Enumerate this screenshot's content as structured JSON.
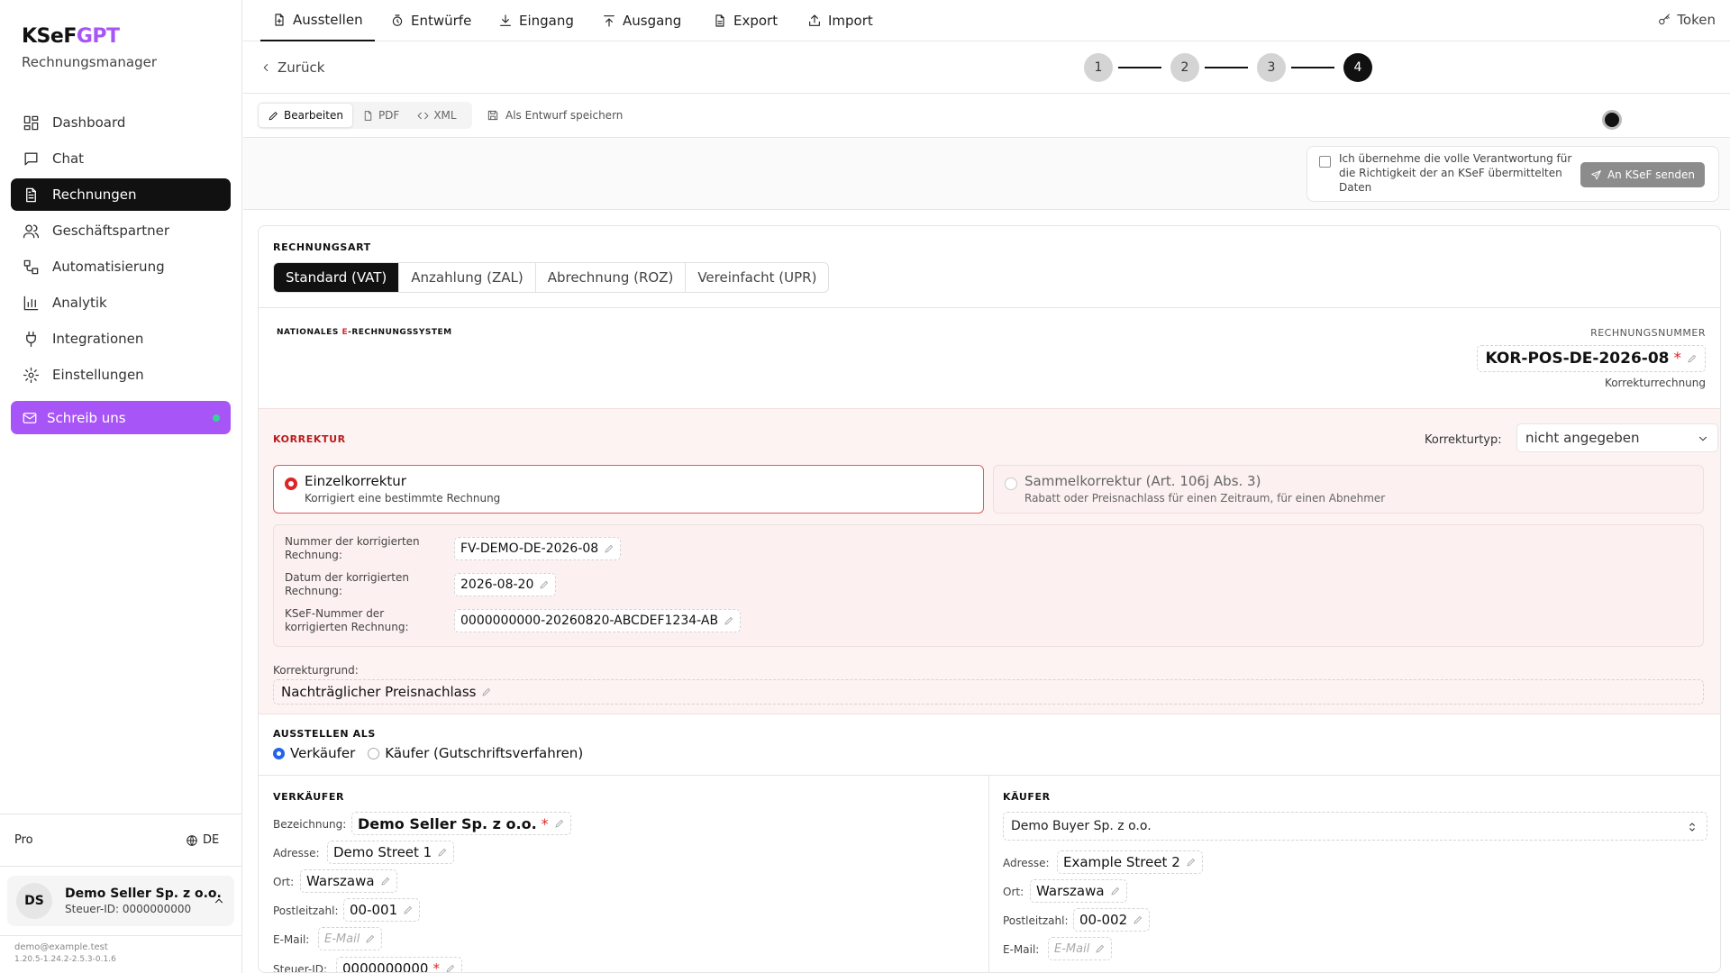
{
  "brand": {
    "name_a": "KSeF",
    "name_b": "GPT",
    "subtitle": "Rechnungsmanager",
    "accent": "#a855f7"
  },
  "sidebar": {
    "items": [
      {
        "label": "Dashboard",
        "icon": "dashboard-icon"
      },
      {
        "label": "Chat",
        "icon": "chat-icon"
      },
      {
        "label": "Rechnungen",
        "icon": "invoice-icon",
        "active": true
      },
      {
        "label": "Geschäftspartner",
        "icon": "users-icon"
      },
      {
        "label": "Automatisierung",
        "icon": "workflow-icon"
      },
      {
        "label": "Analytik",
        "icon": "chart-icon"
      },
      {
        "label": "Integrationen",
        "icon": "plug-icon"
      },
      {
        "label": "Einstellungen",
        "icon": "gear-icon"
      }
    ],
    "cta": "Schreib uns",
    "plan": "Pro",
    "lang": "DE",
    "user": {
      "initials": "DS",
      "name": "Demo Seller Sp. z o.o.",
      "tax_id": "Steuer-ID: 0000000000"
    },
    "email": "demo@example.test",
    "version": "1.20.5-1.24.2-2.5.3-0.1.6"
  },
  "topnav": {
    "tabs": [
      {
        "label": "Ausstellen",
        "icon": "file-plus-icon",
        "active": true
      },
      {
        "label": "Entwürfe",
        "icon": "drafts-icon"
      },
      {
        "label": "Eingang",
        "icon": "download-icon"
      },
      {
        "label": "Ausgang",
        "icon": "upload-icon"
      },
      {
        "label": "Export",
        "icon": "file-export-icon"
      },
      {
        "label": "Import",
        "icon": "import-icon"
      }
    ],
    "token": "Token"
  },
  "back": "Zurück",
  "steps": [
    "1",
    "2",
    "3",
    "4"
  ],
  "current_step": 4,
  "toolbar": {
    "edit": "Bearbeiten",
    "pdf": "PDF",
    "xml": "XML",
    "save_draft": "Als Entwurf speichern"
  },
  "confirm": {
    "text": "Ich übernehme die volle Verantwortung für die Richtigkeit der an KSeF übermittelten Daten",
    "send": "An KSeF senden"
  },
  "invoice_type": {
    "title": "RECHNUNGSART",
    "options": [
      "Standard (VAT)",
      "Anzahlung (ZAL)",
      "Abrechnung (ROZ)",
      "Vereinfacht (UPR)"
    ],
    "selected": "Standard (VAT)"
  },
  "header": {
    "system_a": "NATIONALES ",
    "system_b": "E",
    "system_c": "-RECHNUNGSSYSTEM",
    "number_label": "RECHNUNGSNUMMER",
    "number": "KOR-POS-DE-2026-08",
    "required": "*",
    "number_sub": "Korrekturrechnung"
  },
  "correction": {
    "title": "KORREKTUR",
    "type_label": "Korrekturtyp:",
    "type_value": "nicht angegeben",
    "opt1_title": "Einzelkorrektur",
    "opt1_desc": "Korrigiert eine bestimmte Rechnung",
    "opt2_title": "Sammelkorrektur (Art. 106j Abs. 3)",
    "opt2_desc": "Rabatt oder Preisnachlass für einen Zeitraum, für einen Abnehmer",
    "fields": [
      {
        "label": "Nummer der korrigierten Rechnung:",
        "value": "FV-DEMO-DE-2026-08"
      },
      {
        "label": "Datum der korrigierten Rechnung:",
        "value": "2026-08-20"
      },
      {
        "label": "KSeF-Nummer der korrigierten Rechnung:",
        "value": "0000000000-20260820-ABCDEF1234-AB"
      }
    ],
    "reason_label": "Korrekturgrund:",
    "reason": "Nachträglicher Preisnachlass"
  },
  "issue_as": {
    "title": "AUSSTELLEN ALS",
    "seller": "Verkäufer",
    "buyer": "Käufer (Gutschriftsverfahren)",
    "selected": "Verkäufer"
  },
  "seller": {
    "title": "VERKÄUFER",
    "name_label": "Bezeichnung:",
    "name": "Demo Seller Sp. z o.o.",
    "address_label": "Adresse:",
    "address": "Demo Street 1",
    "city_label": "Ort:",
    "city": "Warszawa",
    "zip_label": "Postleitzahl:",
    "zip": "00-001",
    "email_label": "E-Mail:",
    "email_ph": "E-Mail",
    "taxid_label": "Steuer-ID:",
    "taxid": "0000000000"
  },
  "buyer": {
    "title": "KÄUFER",
    "select": "Demo Buyer Sp. z o.o.",
    "address_label": "Adresse:",
    "address": "Example Street 2",
    "city_label": "Ort:",
    "city": "Warszawa",
    "zip_label": "Postleitzahl:",
    "zip": "00-002",
    "email_label": "E-Mail:",
    "email_ph": "E-Mail"
  }
}
